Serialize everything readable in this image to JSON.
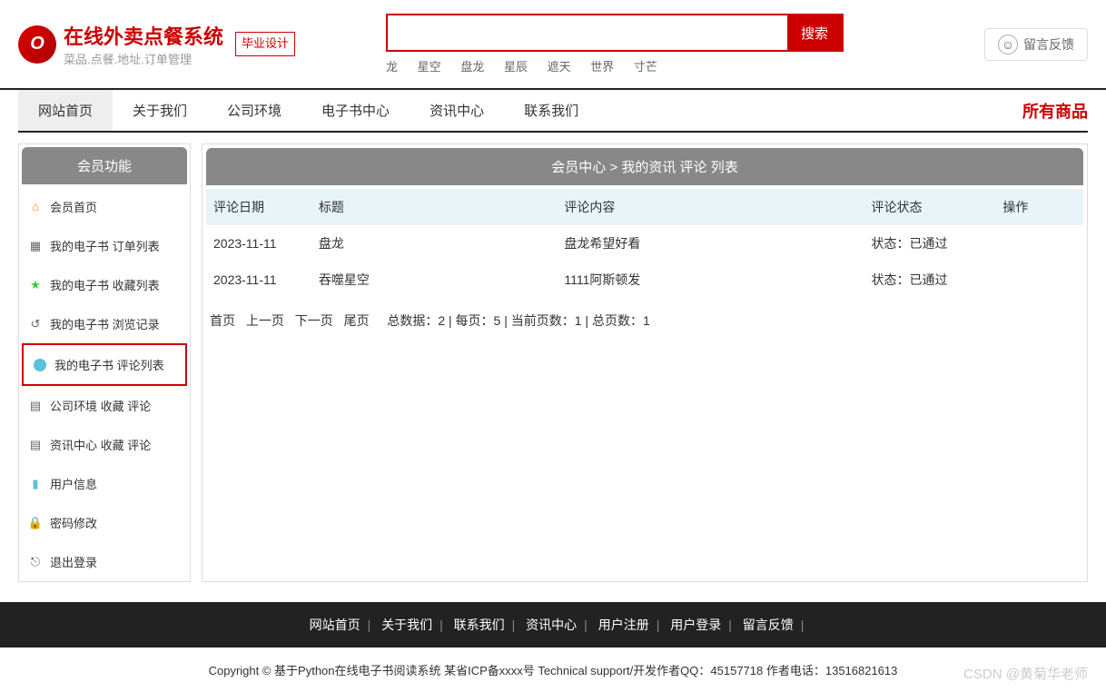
{
  "header": {
    "logo_title": "在线外卖点餐系统",
    "logo_subtitle": "菜品.点餐.地址.订单管理",
    "logo_badge": "毕业设计",
    "search_button": "搜索",
    "search_placeholder": "",
    "hot_tags": [
      "龙",
      "星空",
      "盘龙",
      "星辰",
      "遮天",
      "世界",
      "寸芒"
    ],
    "feedback_label": "留言反馈"
  },
  "nav": {
    "items": [
      "网站首页",
      "关于我们",
      "公司环境",
      "电子书中心",
      "资讯中心",
      "联系我们"
    ],
    "all_products": "所有商品"
  },
  "sidebar": {
    "title": "会员功能",
    "items": [
      {
        "label": "会员首页",
        "icon": "home"
      },
      {
        "label": "我的电子书 订单列表",
        "icon": "grid"
      },
      {
        "label": "我的电子书 收藏列表",
        "icon": "star"
      },
      {
        "label": "我的电子书 浏览记录",
        "icon": "clock"
      },
      {
        "label": "我的电子书 评论列表",
        "icon": "comment",
        "active": true
      },
      {
        "label": "公司环境   收藏   评论",
        "icon": "doc"
      },
      {
        "label": "资讯中心   收藏   评论",
        "icon": "doc"
      },
      {
        "label": "用户信息",
        "icon": "user"
      },
      {
        "label": "密码修改",
        "icon": "lock"
      },
      {
        "label": "退出登录",
        "icon": "exit"
      }
    ]
  },
  "content": {
    "breadcrumb": "会员中心 > 我的资讯 评论 列表",
    "columns": [
      "评论日期",
      "标题",
      "评论内容",
      "评论状态",
      "操作"
    ],
    "rows": [
      {
        "date": "2023-11-11",
        "title": "盘龙",
        "content": "盘龙希望好看",
        "status": "状态：已通过",
        "action": ""
      },
      {
        "date": "2023-11-11",
        "title": "吞噬星空",
        "content": "1111阿斯顿发",
        "status": "状态：已通过",
        "action": ""
      }
    ],
    "pagination": {
      "first": "首页",
      "prev": "上一页",
      "next": "下一页",
      "last": "尾页",
      "info": "总数据：2 | 每页：5 | 当前页数：1 | 总页数：1"
    }
  },
  "footer": {
    "links": [
      "网站首页",
      "关于我们",
      "联系我们",
      "资讯中心",
      "用户注册",
      "用户登录",
      "留言反馈"
    ]
  },
  "copyright": {
    "text": "Copyright © 基于Python在线电子书阅读系统 某省ICP备xxxx号     Technical support/开发作者QQ：45157718     作者电话：13516821613",
    "watermark": "CSDN @黄菊华老师"
  }
}
